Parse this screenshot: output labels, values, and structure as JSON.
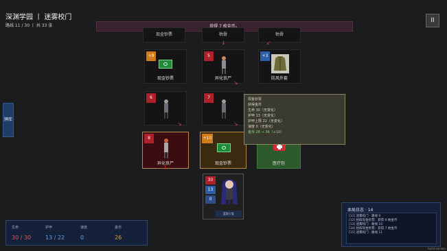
{
  "header": {
    "title": "深渊学园 丨 迷雾校门",
    "progress": "路线 11 / 30 丨 共 33 张"
  },
  "banner": "获得 7 枚金币。",
  "pause_label": "II",
  "side_tab": "牌库",
  "top_labels": [
    "现金钞票",
    "枯骨",
    "枯骨"
  ],
  "cards": [
    {
      "label": "现金钞票",
      "badge": "+9"
    },
    {
      "label": "异化丧尸",
      "badge": "5"
    },
    {
      "label": "防风外套",
      "badge": "+3"
    },
    {
      "label": "",
      "badge": "6"
    },
    {
      "label": "",
      "badge": "7"
    },
    {
      "label": "异化丧尸",
      "badge": "8"
    },
    {
      "label": "现金钞票",
      "badge": "+10"
    },
    {
      "label": "医疗包",
      "badge": ""
    }
  ],
  "tooltip": {
    "lines": [
      "现金钞票",
      "获得金币",
      "生命  30（无变化）",
      "护甲  13（无变化）",
      "护甲上限 22（无变化）",
      "速度  0（无变化）",
      "金币  26 → 36（+10）"
    ]
  },
  "player": {
    "hp": "30",
    "armor": "13",
    "speed": "0",
    "name": "蓝发少女"
  },
  "stats": {
    "labels": [
      "生命",
      "护甲",
      "速度",
      "金币"
    ],
    "values": [
      "30 / 30",
      "13 / 22",
      "0",
      "26"
    ]
  },
  "log": {
    "title": "本局日志 · 14",
    "lines": [
      "[11] 迷雾校门 · 路线 9",
      "[12] 拾取现金钞票：获得 6 枚金币",
      "[13] 迷雾校门 · 路线 10",
      "[14] 拾取现金钞票：获得 7 枚金币",
      "[15] 迷雾校门 · 路线 11"
    ]
  },
  "corner_text": "build version"
}
